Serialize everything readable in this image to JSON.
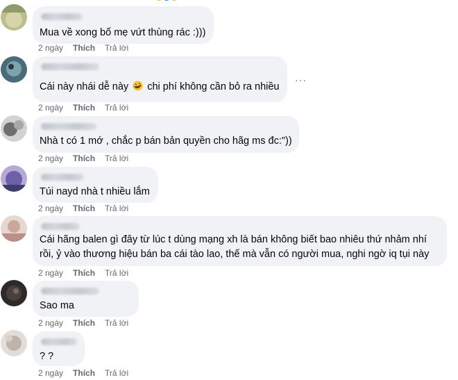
{
  "comments": [
    {
      "text": "Mua về xong bố mẹ vứt thùng rác :)))",
      "time": "2 ngày",
      "like": "Thích",
      "reply": "Trả lời"
    },
    {
      "text_before": "Cái này nhái dễ này",
      "text_after": "chi phí không cần bỏ ra nhiều",
      "emoji": "rolling-on-floor-laughing",
      "time": "2 ngày",
      "like": "Thích",
      "reply": "Trả lời",
      "more": "···"
    },
    {
      "text": "Nhà t có 1 mớ , chắc p bán bản quyền cho hãg ms đc:\"))",
      "time": "2 ngày",
      "like": "Thích",
      "reply": "Trả lời"
    },
    {
      "text": "Túi nayd nhà t nhiều lắm",
      "time": "2 ngày",
      "like": "Thích",
      "reply": "Trả lời"
    },
    {
      "line1": "Cái hãng balen gì đây từ lúc t dùng mạng xh là bán không biết bao nhiêu thứ nhảm nhí",
      "line2": "rồi, ỷ vào thương hiệu bán ba cái tào lao, thế mà vẫn có người mua, nghi ngờ iq tụi này",
      "time": "2 ngày",
      "like": "Thích",
      "reply": "Trả lời"
    },
    {
      "text": "Sao ma",
      "time": "2 ngày",
      "like": "Thích",
      "reply": "Trả lời"
    },
    {
      "text": "? ?",
      "time": "2 ngày",
      "like": "Thích",
      "reply": "Trả lời"
    }
  ],
  "colors": {
    "bubble": "#f0f2f5",
    "meta": "#65676b",
    "text": "#050505"
  }
}
